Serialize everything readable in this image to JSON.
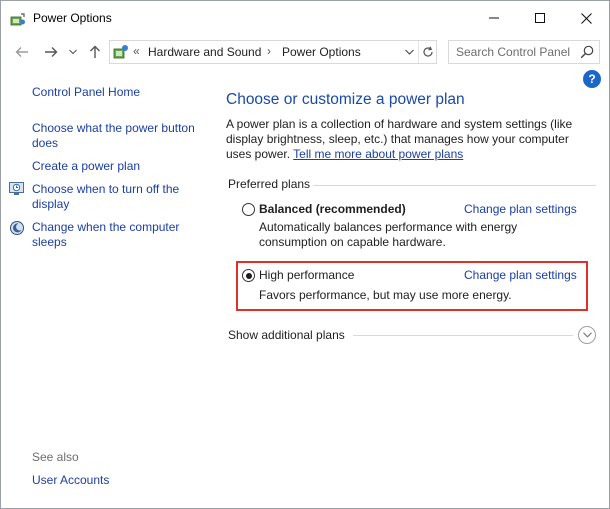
{
  "window": {
    "title": "Power Options",
    "icon": "power-options-icon",
    "controls": [
      "minimize-icon",
      "maximize-icon",
      "close-icon"
    ]
  },
  "navigation": {
    "back_icon": "back-arrow-icon",
    "forward_icon": "forward-arrow-icon",
    "recent_icon": "chevron-down-icon",
    "up_icon": "up-arrow-icon"
  },
  "address_bar": {
    "overflow": "«",
    "breadcrumb": [
      "Hardware and Sound",
      "Power Options"
    ],
    "separator": "›",
    "refresh_icon": "refresh-icon"
  },
  "search": {
    "placeholder": "Search Control Panel",
    "icon": "search-icon"
  },
  "help": {
    "label": "?"
  },
  "sidebar": {
    "home": "Control Panel Home",
    "links": [
      {
        "label": "Choose what the power button does",
        "icon": null
      },
      {
        "label": "Create a power plan",
        "icon": null
      },
      {
        "label": "Choose when to turn off the display",
        "icon": "display-timer-icon"
      },
      {
        "label": "Change when the computer sleeps",
        "icon": "sleep-moon-icon"
      }
    ],
    "see_also_heading": "See also",
    "see_also_links": [
      "User Accounts"
    ]
  },
  "main": {
    "title": "Choose or customize a power plan",
    "description": "A power plan is a collection of hardware and system settings (like display brightness, sleep, etc.) that manages how your computer uses power.",
    "description_link": "Tell me more about power plans",
    "preferred_heading": "Preferred plans",
    "plans": [
      {
        "name": "Balanced (recommended)",
        "selected": false,
        "link": "Change plan settings",
        "description": "Automatically balances performance with energy consumption on capable hardware."
      },
      {
        "name": "High performance",
        "selected": true,
        "link": "Change plan settings",
        "description": "Favors performance, but may use more energy."
      }
    ],
    "additional_plans": "Show additional plans"
  },
  "colors": {
    "link": "#1a3ea4",
    "title": "#1a4aa8",
    "highlight_border": "#e0302a",
    "help_badge": "#1a66c9"
  }
}
